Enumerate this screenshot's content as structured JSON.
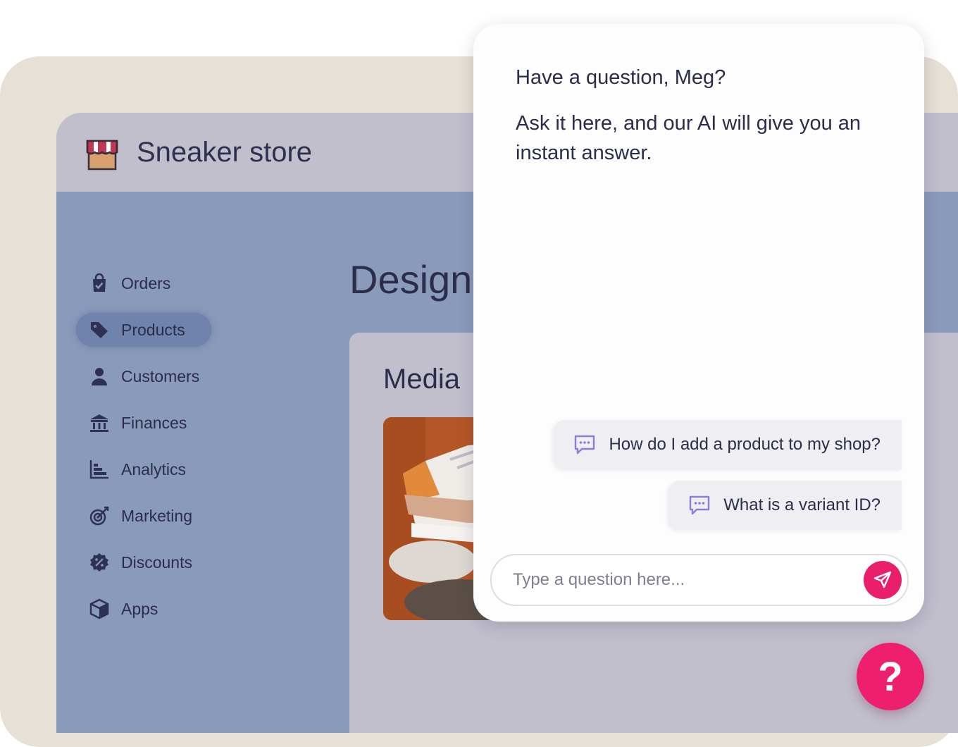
{
  "app": {
    "store_name": "Sneaker store",
    "page_title": "Design",
    "section_title": "Media"
  },
  "sidebar": {
    "items": [
      {
        "label": "Orders",
        "icon": "shopping-bag-icon",
        "active": false
      },
      {
        "label": "Products",
        "icon": "tag-icon",
        "active": true
      },
      {
        "label": "Customers",
        "icon": "person-icon",
        "active": false
      },
      {
        "label": "Finances",
        "icon": "bank-icon",
        "active": false
      },
      {
        "label": "Analytics",
        "icon": "bar-chart-icon",
        "active": false
      },
      {
        "label": "Marketing",
        "icon": "target-icon",
        "active": false
      },
      {
        "label": "Discounts",
        "icon": "discount-badge-icon",
        "active": false
      },
      {
        "label": "Apps",
        "icon": "cube-icon",
        "active": false
      }
    ]
  },
  "chat": {
    "greeting": "Have a question, Meg?",
    "intro": "Ask it here, and our AI will give you an instant answer.",
    "suggestions": [
      {
        "text": "How do I add a product to my shop?"
      },
      {
        "text": "What is a variant ID?"
      }
    ],
    "input": {
      "placeholder": "Type a question here...",
      "value": ""
    }
  },
  "help_button": {
    "label": "?"
  },
  "colors": {
    "accent": "#ee1f6d",
    "sidebar_bg": "#8a9aba",
    "header_bg": "#c1bfcc",
    "backdrop": "#e6e0d6"
  }
}
